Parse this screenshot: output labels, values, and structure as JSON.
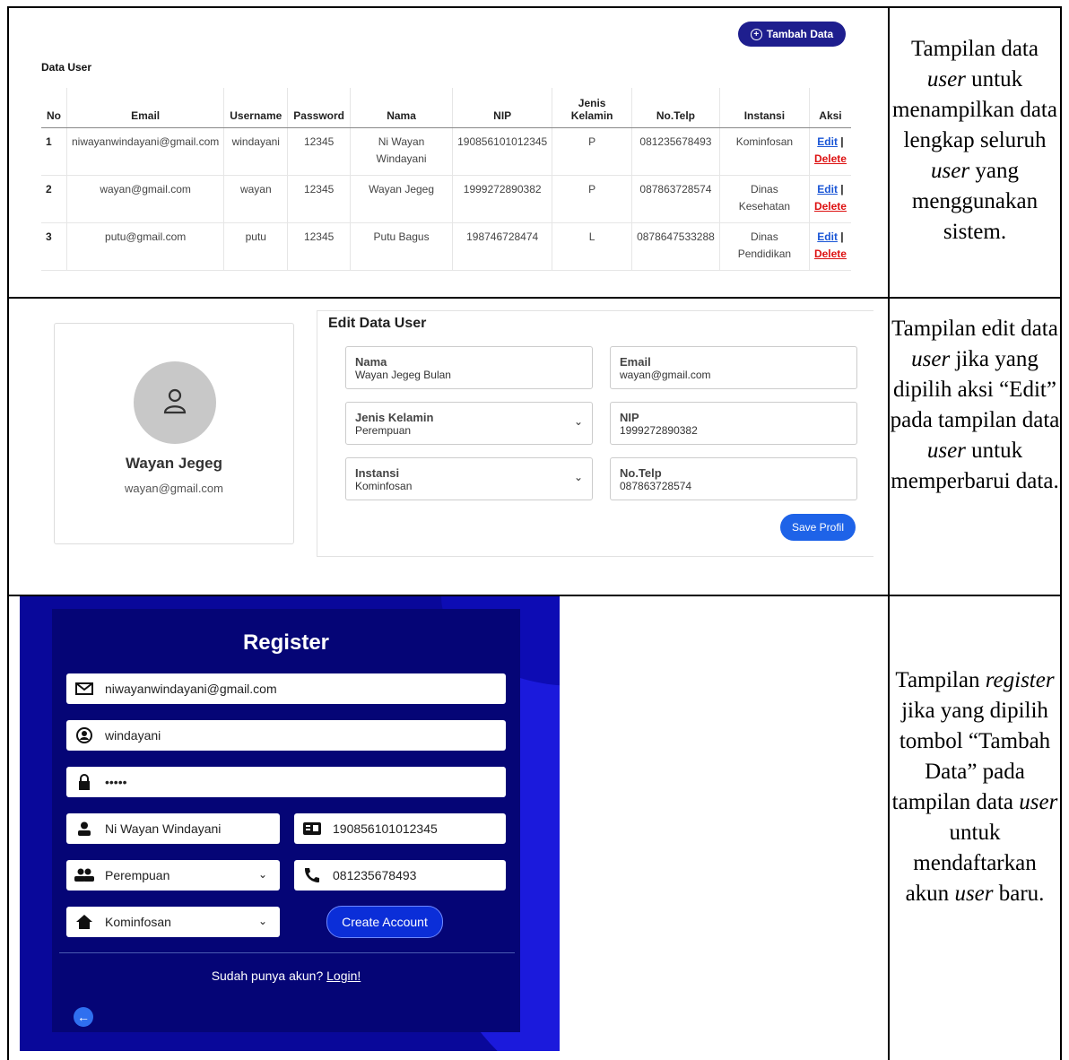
{
  "data_user": {
    "tambah_label": "Tambah Data",
    "title": "Data User",
    "columns": [
      "No",
      "Email",
      "Username",
      "Password",
      "Nama",
      "NIP",
      "Jenis Kelamin",
      "No.Telp",
      "Instansi",
      "Aksi"
    ],
    "rows": [
      {
        "no": "1",
        "email": "niwayanwindayani@gmail.com",
        "username": "windayani",
        "password": "12345",
        "nama": "Ni Wayan Windayani",
        "nip": "190856101012345",
        "jk": "P",
        "telp": "081235678493",
        "instansi": "Kominfosan"
      },
      {
        "no": "2",
        "email": "wayan@gmail.com",
        "username": "wayan",
        "password": "12345",
        "nama": "Wayan Jegeg",
        "nip": "1999272890382",
        "jk": "P",
        "telp": "087863728574",
        "instansi": "Dinas Kesehatan"
      },
      {
        "no": "3",
        "email": "putu@gmail.com",
        "username": "putu",
        "password": "12345",
        "nama": "Putu Bagus",
        "nip": "198746728474",
        "jk": "L",
        "telp": "0878647533288",
        "instansi": "Dinas Pendidikan"
      }
    ],
    "edit_label": "Edit",
    "separator": "|",
    "delete_label": "Delete"
  },
  "edit_user": {
    "profile_name": "Wayan Jegeg",
    "profile_email": "wayan@gmail.com",
    "title": "Edit Data User",
    "nama_label": "Nama",
    "nama_value": "Wayan Jegeg Bulan",
    "email_label": "Email",
    "email_value": "wayan@gmail.com",
    "jk_label": "Jenis Kelamin",
    "jk_value": "Perempuan",
    "nip_label": "NIP",
    "nip_value": "1999272890382",
    "instansi_label": "Instansi",
    "instansi_value": "Kominfosan",
    "telp_label": "No.Telp",
    "telp_value": "087863728574",
    "save_label": "Save Profil"
  },
  "register": {
    "title": "Register",
    "email": "niwayanwindayani@gmail.com",
    "username": "windayani",
    "password": "•••••",
    "nama": "Ni Wayan Windayani",
    "nip": "190856101012345",
    "jenis_kelamin": "Perempuan",
    "telp": "081235678493",
    "instansi": "Kominfosan",
    "create_label": "Create Account",
    "login_prompt": "Sudah punya akun?",
    "login_link": "Login!"
  },
  "descriptions": {
    "d1": [
      "Tampilan data ",
      "user",
      " untuk menampilkan data lengkap seluruh ",
      "user",
      " yang menggunakan sistem."
    ],
    "d2": [
      "Tampilan edit data ",
      "user",
      " jika yang dipilih aksi “Edit” pada tampilan data ",
      "user",
      " untuk memperbarui data."
    ],
    "d3": [
      "Tampilan ",
      "register",
      " jika yang dipilih tombol “Tambah Data” pada tampilan data ",
      "user",
      " untuk mendaftarkan akun ",
      "user",
      " baru."
    ]
  }
}
